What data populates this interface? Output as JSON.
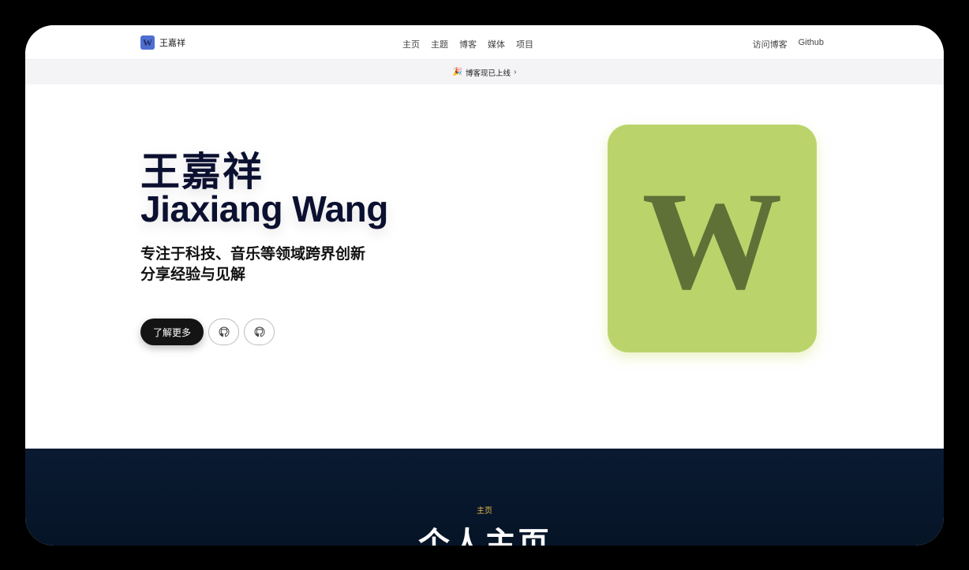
{
  "brand": {
    "logo_letter": "W",
    "name": "王嘉祥"
  },
  "nav": {
    "items": [
      {
        "label": "主页"
      },
      {
        "label": "主题"
      },
      {
        "label": "博客"
      },
      {
        "label": "媒体"
      },
      {
        "label": "项目"
      }
    ],
    "right": [
      {
        "label": "访问博客"
      },
      {
        "label": "Github"
      }
    ]
  },
  "announcement": {
    "icon": "party-icon",
    "text": "博客现已上线",
    "chevron": "›"
  },
  "hero": {
    "name_cn": "王嘉祥",
    "name_en": "Jiaxiang Wang",
    "tagline_line1": "专注于科技、音乐等领域跨界创新",
    "tagline_line2": "分享经验与见解",
    "primary_button": "了解更多",
    "icon_buttons": [
      {
        "icon": "github-icon"
      },
      {
        "icon": "github-icon"
      }
    ],
    "logo_letter": "W",
    "logo_color": "#bad46b",
    "logo_letter_color": "#5f7137"
  },
  "section": {
    "kicker": "主页",
    "title": "个人主页"
  },
  "colors": {
    "accent": "#e7b74a",
    "dark_bg": "#0a1a31",
    "brand_blue": "#4f6fd0"
  }
}
